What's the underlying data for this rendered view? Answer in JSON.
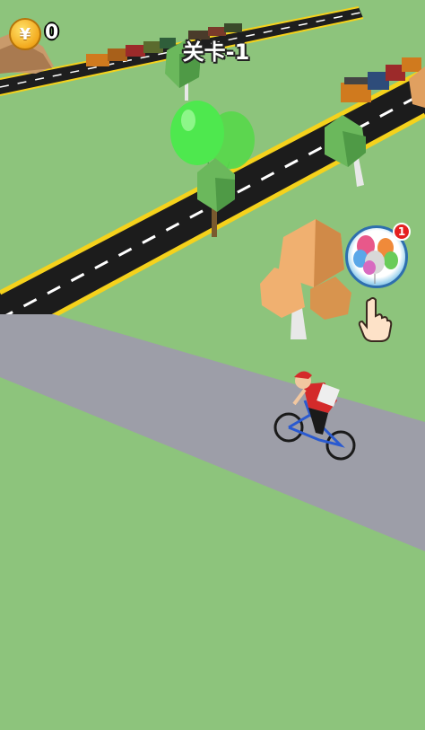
{
  "hud": {
    "coin_symbol": "¥",
    "coin_count": "0",
    "level_label": "关卡-1"
  },
  "balloon_button": {
    "badge_count": "1"
  },
  "colors": {
    "grass": "#8dc47c",
    "road": "#1c1c1c",
    "road_edge": "#f5d21c",
    "bike_path": "#9d9ea8",
    "balloon_green": "#4ee84e",
    "coin": "#f2a81d",
    "badge": "#e42020"
  },
  "icons": [
    "coin-icon",
    "balloon-bundle-icon",
    "tap-hand-icon"
  ]
}
